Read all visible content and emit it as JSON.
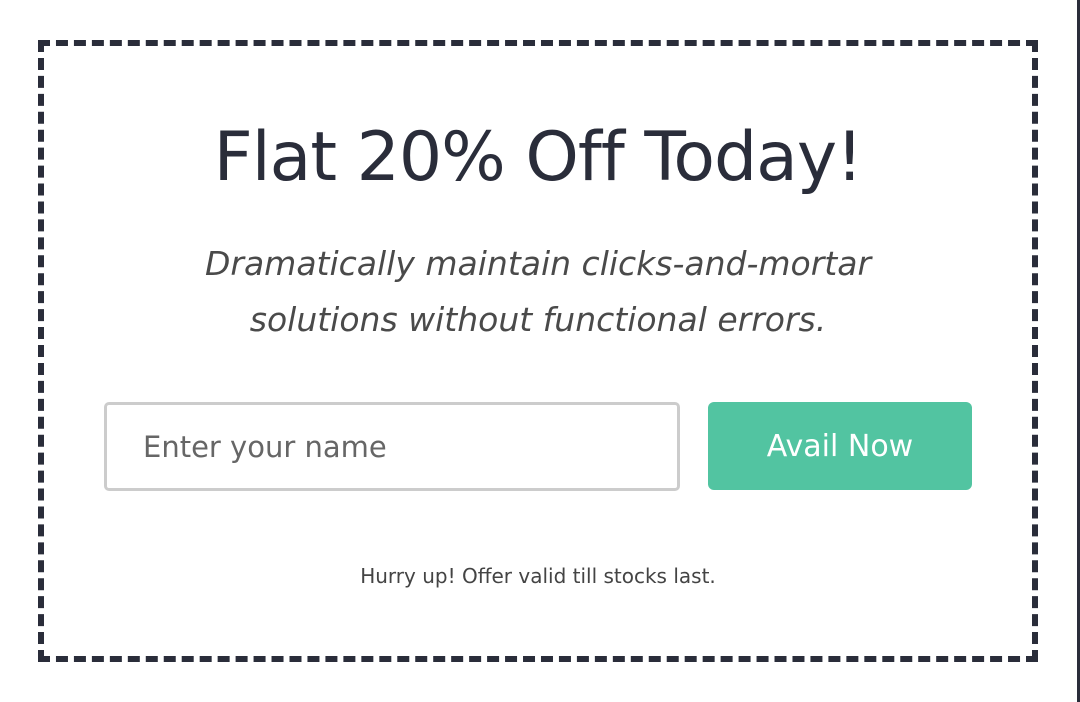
{
  "offer": {
    "title": "Flat 20% Off Today!",
    "subtitle": "Dramatically maintain clicks-and-mortar solutions without functional errors.",
    "name_input": {
      "value": "",
      "placeholder": "Enter your name"
    },
    "button_label": "Avail Now",
    "note": "Hurry up! Offer valid till stocks last."
  },
  "colors": {
    "accent": "#52c4a1",
    "border": "#2a2d3a",
    "text": "#2a2d3a"
  }
}
